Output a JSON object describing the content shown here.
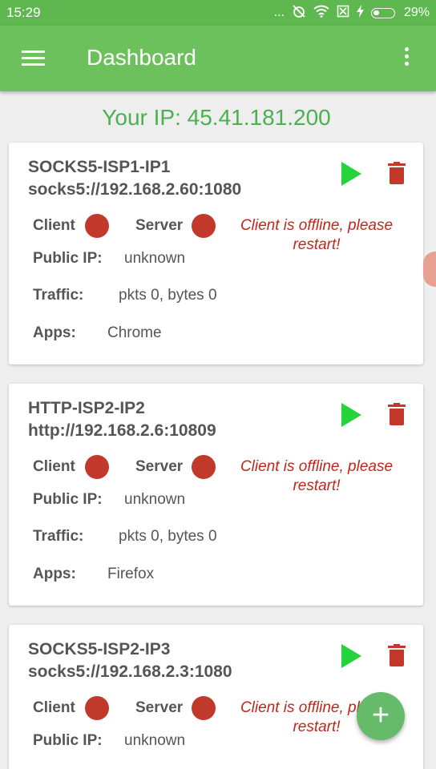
{
  "status_bar": {
    "time": "15:29",
    "dots": "...",
    "battery_percent": "29%"
  },
  "app_bar": {
    "title": "Dashboard"
  },
  "your_ip": "Your IP: 45.41.181.200",
  "labels": {
    "client": "Client",
    "server": "Server",
    "public_ip": "Public IP:",
    "traffic": "Traffic:",
    "apps": "Apps:"
  },
  "colors": {
    "primary": "#6cc15c",
    "status_dot": "#c0392b",
    "play": "#25d33a",
    "error_text": "#c0271c",
    "ip_text": "#4caf50",
    "fab": "#66bb6a"
  },
  "proxies": [
    {
      "name": "SOCKS5-ISP1-IP1",
      "url": "socks5://192.168.2.60:1080",
      "message": "Client is offline, please restart!",
      "public_ip": "unknown",
      "traffic": "pkts 0,  bytes 0",
      "apps": "Chrome"
    },
    {
      "name": "HTTP-ISP2-IP2",
      "url": "http://192.168.2.6:10809",
      "message": "Client is offline, please restart!",
      "public_ip": "unknown",
      "traffic": "pkts 0,  bytes 0",
      "apps": "Firefox"
    },
    {
      "name": "SOCKS5-ISP2-IP3",
      "url": "socks5://192.168.2.3:1080",
      "message": "Client is offline, please restart!",
      "public_ip": "unknown"
    }
  ],
  "fab": {
    "label": "+"
  }
}
